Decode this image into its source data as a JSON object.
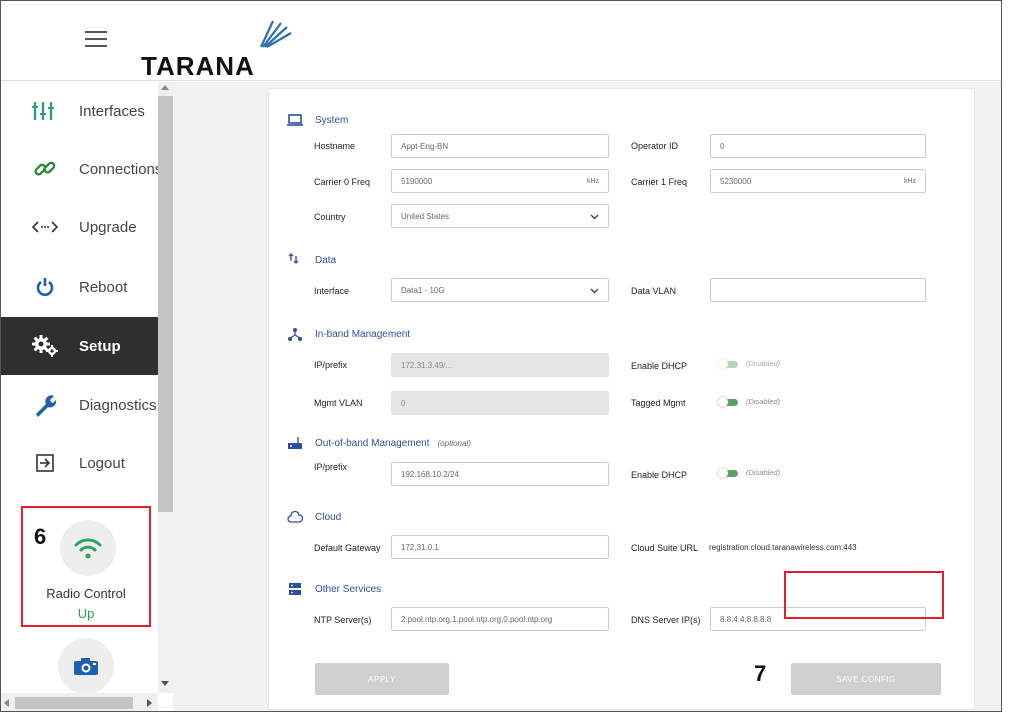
{
  "header": {
    "brand": "TARANA"
  },
  "sidebar": {
    "items": [
      {
        "label": "Interfaces",
        "icon": "interfaces-icon"
      },
      {
        "label": "Connections",
        "icon": "link-icon"
      },
      {
        "label": "Upgrade",
        "icon": "code-arrows-icon"
      },
      {
        "label": "Reboot",
        "icon": "power-icon"
      },
      {
        "label": "Setup",
        "icon": "gears-icon",
        "active": true
      },
      {
        "label": "Diagnostics",
        "icon": "wrench-icon"
      },
      {
        "label": "Logout",
        "icon": "logout-icon"
      }
    ],
    "radio_control": {
      "label": "Radio Control",
      "status": "Up",
      "icon": "wifi-icon"
    },
    "camera": {
      "icon": "camera-icon"
    }
  },
  "annotations": {
    "callout_radio": "6",
    "callout_save": "7",
    "highlight_color": "#e0202a"
  },
  "system": {
    "title": "System",
    "hostname_label": "Hostname",
    "hostname_value": "Appt-Eng-BN",
    "operator_label": "Operator ID",
    "operator_value": "0",
    "carrier0_label": "Carrier 0 Freq",
    "carrier0_value": "5190000",
    "carrier0_unit": "kHz",
    "carrier1_label": "Carrier 1 Freq",
    "carrier1_value": "5230000",
    "carrier1_unit": "kHz",
    "country_label": "Country",
    "country_value": "United States"
  },
  "data": {
    "title": "Data",
    "interface_label": "Interface",
    "interface_value": "Data1 - 10G",
    "vlan_label": "Data VLAN",
    "vlan_value": ""
  },
  "inband": {
    "title": "In-band Management",
    "ip_label": "IP/prefix",
    "ip_value": "172.31.3.49/...",
    "dhcp_label": "Enable DHCP",
    "dhcp_state": "(Disabled)",
    "vlan_label": "Mgmt VLAN",
    "vlan_value": "0",
    "tagged_label": "Tagged Mgmt",
    "tagged_state": "(Disabled)"
  },
  "outband": {
    "title": "Out-of-band Management",
    "optional": "(optional)",
    "ip_label": "IP/prefix",
    "ip_value": "192.168.10.2/24",
    "dhcp_label": "Enable DHCP",
    "dhcp_state": "(Disabled)"
  },
  "cloud": {
    "title": "Cloud",
    "gateway_label": "Default Gateway",
    "gateway_value": "172.31.0.1",
    "url_label": "Cloud Suite URL",
    "url_value": "registration.cloud.taranawireless.com:443"
  },
  "services": {
    "title": "Other Services",
    "ntp_label": "NTP Server(s)",
    "ntp_value": "2.pool.ntp.org,1.pool.ntp.org,0.pool.ntp.org",
    "dns_label": "DNS Server IP(s)",
    "dns_value": "8.8.4.4,8.8.8.8"
  },
  "buttons": {
    "apply": "APPLY",
    "save": "SAVE CONFIG"
  },
  "colors": {
    "accent": "#2d4fa0",
    "active_nav": "#2f2f2f",
    "toggle_green": "#2e8b3a",
    "status_up": "#2e9e3a"
  }
}
